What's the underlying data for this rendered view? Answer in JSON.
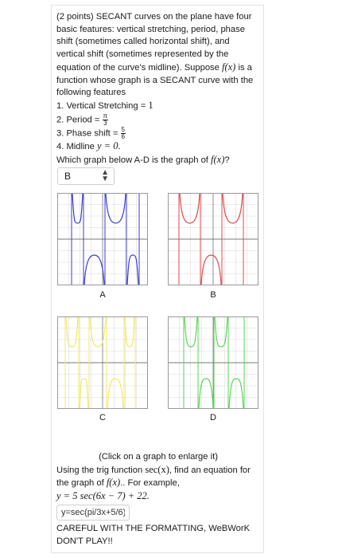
{
  "question": {
    "intro": "(2 points) SECANT curves on the plane have four basic features: vertical stretching, period, phase shift (sometimes called horizontal shift), and vertical shift (sometimes represented by the equation of the curve's midline). Suppose",
    "fx": "f(x)",
    "intro2": "is a function whose graph is a SECANT curve with the following features",
    "features": {
      "f1_label": "1. Vertical Stretching =",
      "f1_value": "1",
      "f2_label": "2. Period =",
      "f2_num": "π",
      "f2_den": "3",
      "f3_label": "3. Phase shift =",
      "f3_num": "5",
      "f3_den": "6",
      "f4_label": "4. Midline",
      "f4_value": "y = 0."
    },
    "prompt": "Which graph below A-D is the graph of",
    "prompt_fx": "f(x)",
    "prompt_end": "?"
  },
  "select": {
    "value": "B"
  },
  "graphs": [
    {
      "label": "A",
      "color": "#3b3bd6"
    },
    {
      "label": "B",
      "color": "#e04a4a"
    },
    {
      "label": "C",
      "color": "#f2e96a"
    },
    {
      "label": "D",
      "color": "#5ad45a"
    }
  ],
  "bottom": {
    "enlarge": "(Click on a graph to enlarge it)",
    "line1": "Using the trig function",
    "sec": "sec(x)",
    "line1b": ", find an equation for the graph of",
    "fx": "f(x)",
    "line1c": ".. For example,",
    "example": "y = 5 sec(6x − 7) + 22.",
    "answer_value": "y=sec(pi/3x+5/6)",
    "warning": "CAREFUL WITH THE FORMATTING, WeBWorK DON'T PLAY!!"
  }
}
